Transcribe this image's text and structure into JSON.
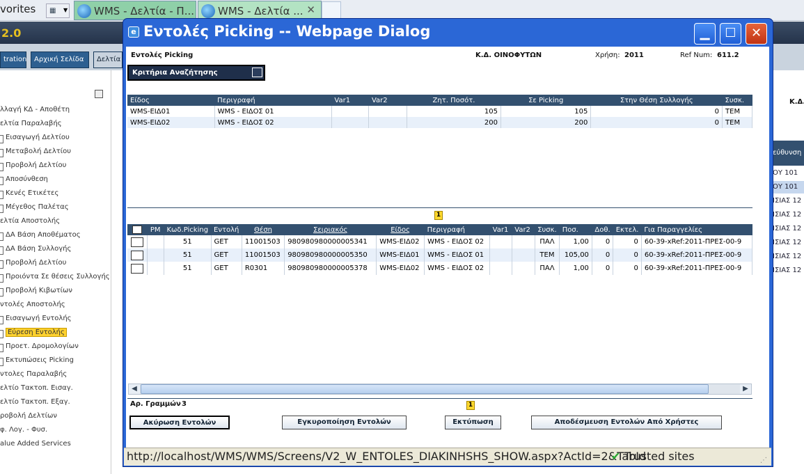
{
  "browser": {
    "favorites_label": "vorites",
    "tabs": [
      {
        "label": "WMS - Δελτία - Π..."
      },
      {
        "label": "WMS - Δελτία ..."
      }
    ]
  },
  "app": {
    "version": "2.0",
    "nav_buttons": [
      "tration",
      "Αρχική Σελίδα",
      "Δελτία"
    ],
    "sidebar": [
      {
        "label": "λλαγή ΚΔ - Αποθέτη",
        "sub": false
      },
      {
        "label": "ελτία Παραλαβής",
        "sub": false
      },
      {
        "label": "Εισαγωγή Δελτίου",
        "sub": true
      },
      {
        "label": "Μεταβολή Δελτίου",
        "sub": true
      },
      {
        "label": "Προβολή Δελτίου",
        "sub": true
      },
      {
        "label": "Αποσύνθεση",
        "sub": true
      },
      {
        "label": "Κενές Ετικέτες",
        "sub": true
      },
      {
        "label": "Μέγεθος Παλέτας",
        "sub": true
      },
      {
        "label": "ελτία Αποστολής",
        "sub": false
      },
      {
        "label": "ΔΑ Βάση Αποθέματος",
        "sub": true
      },
      {
        "label": "ΔΑ Βάση Συλλογής",
        "sub": true
      },
      {
        "label": "Προβολή Δελτίου",
        "sub": true
      },
      {
        "label": "Προιόντα Σε θέσεις Συλλογής",
        "sub": true
      },
      {
        "label": "Προβολή Κιβωτίων",
        "sub": true
      },
      {
        "label": "ντολές Αποστολής",
        "sub": false
      },
      {
        "label": "Εισαγωγή Εντολής",
        "sub": true
      },
      {
        "label": "Εύρεση Εντολής",
        "sub": true,
        "selected": true
      },
      {
        "label": "Προετ. Δρομολογίων",
        "sub": true
      },
      {
        "label": "Εκτυπώσεις Picking",
        "sub": true
      },
      {
        "label": "ντολες Παραλαβής",
        "sub": false
      },
      {
        "label": "ελτίο Τακτοπ. Εισαγ.",
        "sub": false
      },
      {
        "label": "ελτίο Τακτοπ. Εξαγ.",
        "sub": false
      },
      {
        "label": "ροβολή Δελτίων",
        "sub": false
      },
      {
        "label": "φ. Λογ. - Φυσ.",
        "sub": false
      },
      {
        "label": "alue Added Services",
        "sub": false
      }
    ],
    "right_header": "Κ.Δ.",
    "right_col_header": "εύθυνση",
    "right_rows": [
      "ΟΥ 101",
      "ΟΥ 101",
      "ΙΣΙΑΣ 12",
      "ΙΣΙΑΣ 12",
      "ΙΣΙΑΣ 12",
      "ΙΣΙΑΣ 12",
      "ΙΣΙΑΣ 12",
      "ΙΣΙΑΣ 12"
    ]
  },
  "dialog": {
    "title": "Εντολές Picking -- Webpage Dialog",
    "header": {
      "page_label": "Εντολές Picking",
      "kd_label": "Κ.Δ. ΟΙΝΟΦΥΤΩΝ",
      "year_label": "Χρήση:",
      "year_value": "2011",
      "ref_label": "Ref Num:",
      "ref_value": "611.2"
    },
    "criteria_label": "Κριτήρια Αναζήτησης",
    "summary_table": {
      "columns": [
        "Είδος",
        "Περιγραφή",
        "Var1",
        "Var2",
        "Ζητ. Ποσότ.",
        "Σε Picking",
        "Στην Θέση Συλλογής",
        "Συσκ."
      ],
      "rows": [
        [
          "WMS-ΕΙΔ01",
          "WMS - ΕΙΔΟΣ 01",
          "",
          "",
          "105",
          "105",
          "0",
          "TEM"
        ],
        [
          "WMS-ΕΙΔ02",
          "WMS - ΕΙΔΟΣ 02",
          "",
          "",
          "200",
          "200",
          "0",
          "TEM"
        ]
      ]
    },
    "page_top": "1",
    "detail_table": {
      "columns": [
        "PM",
        "Κωδ.Picking",
        "Εντολή",
        "Θέση",
        "Σειριακός",
        "Είδος",
        "Περιγραφή",
        "Var1",
        "Var2",
        "Συσκ.",
        "Ποσ.",
        "Δοθ.",
        "Εκτελ.",
        "Για Παραγγελίες"
      ],
      "rows": [
        [
          "",
          "51",
          "GET",
          "11001503",
          "980980980000005341",
          "WMS-ΕΙΔ02",
          "WMS - ΕΙΔΟΣ 02",
          "",
          "",
          "ΠΑΛ",
          "1,00",
          "0",
          "0",
          "60-39-xRef:2011-ΠΡΕΣ-00-9"
        ],
        [
          "",
          "51",
          "GET",
          "11001503",
          "980980980000005350",
          "WMS-ΕΙΔ01",
          "WMS - ΕΙΔΟΣ 01",
          "",
          "",
          "TEM",
          "105,00",
          "0",
          "0",
          "60-39-xRef:2011-ΠΡΕΣ-00-9"
        ],
        [
          "",
          "51",
          "GET",
          "R0301",
          "980980980000005378",
          "WMS-ΕΙΔ02",
          "WMS - ΕΙΔΟΣ 02",
          "",
          "",
          "ΠΑΛ",
          "1,00",
          "0",
          "0",
          "60-39-xRef:2011-ΠΡΕΣ-00-9"
        ]
      ]
    },
    "row_count_label": "Αρ. Γραμμών",
    "row_count_value": "3",
    "page_bottom": "1",
    "buttons": {
      "cancel": "Ακύρωση Εντολών",
      "validate": "Εγκυροποίηση Εντολών",
      "print": "Εκτύπωση",
      "release": "Αποδέσμευση Εντολών Από Χρήστες"
    },
    "status": {
      "url": "http://localhost/WMS/WMS/Screens/V2_W_ENTOLES_DIAKINHSHS_SHOW.aspx?ActId=2&TabId",
      "zone": "Trusted sites"
    }
  }
}
